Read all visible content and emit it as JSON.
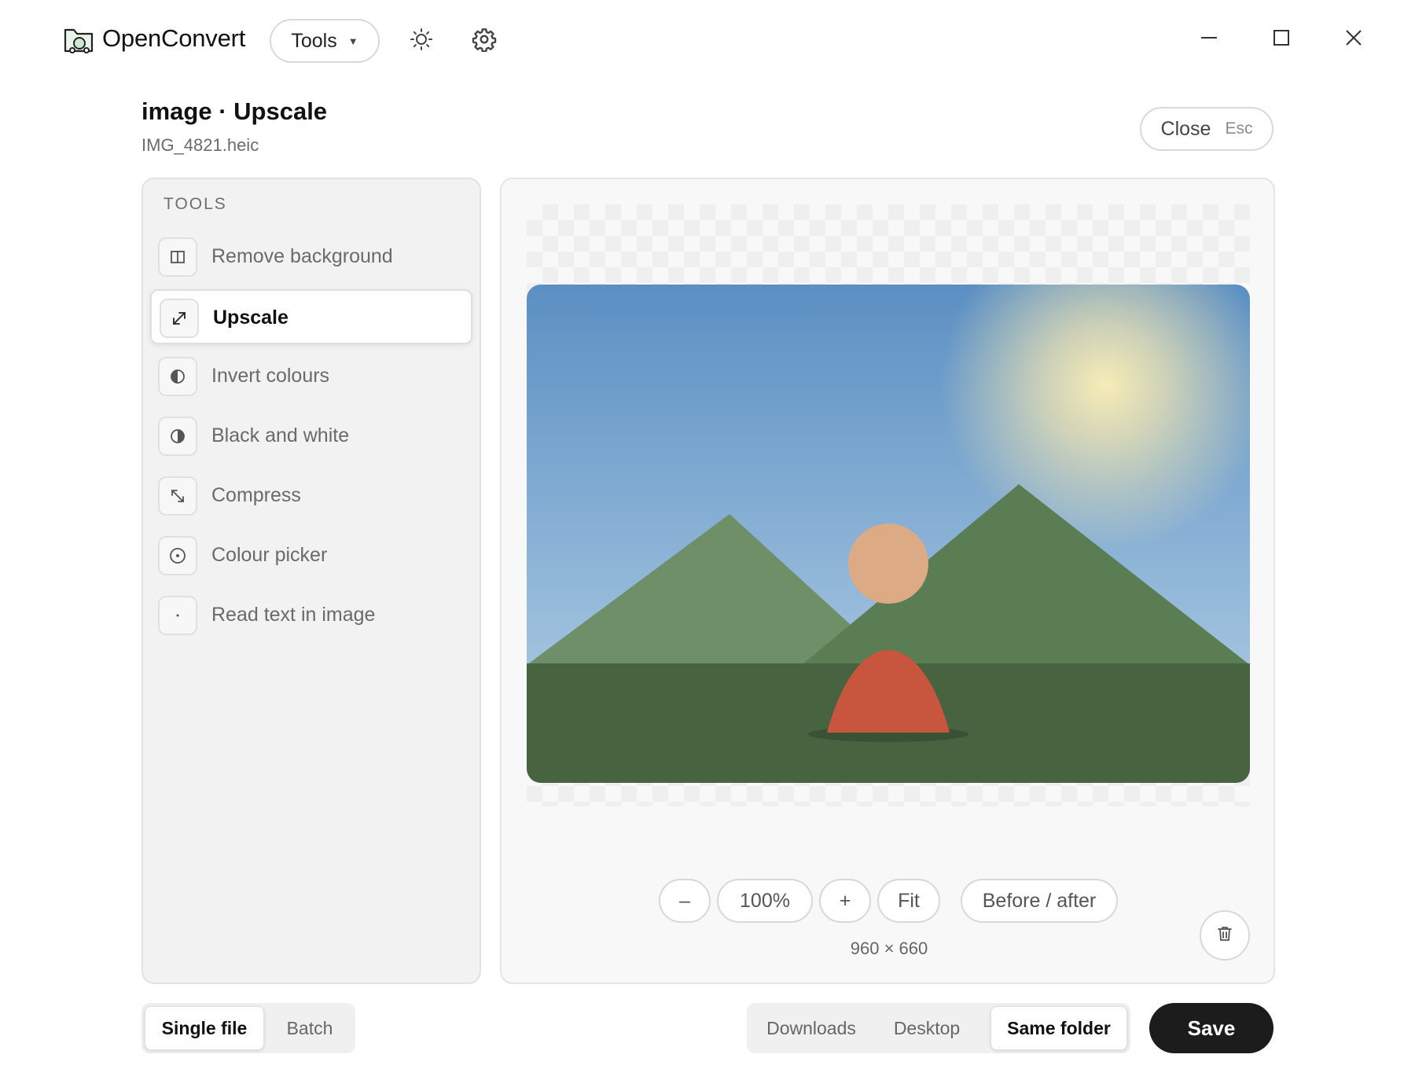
{
  "app": {
    "name": "OpenConvert"
  },
  "titlebar": {
    "tools_label": "Tools"
  },
  "header": {
    "title": "image · Upscale",
    "file_name": "IMG_4821.heic",
    "close_label": "Close",
    "close_shortcut": "Esc"
  },
  "sidebar": {
    "heading": "TOOLS",
    "items": [
      {
        "label": "Remove background",
        "icon": "remove-background-icon"
      },
      {
        "label": "Upscale",
        "icon": "upscale-icon",
        "active": true
      },
      {
        "label": "Invert colours",
        "icon": "invert-icon"
      },
      {
        "label": "Black and white",
        "icon": "black-white-icon"
      },
      {
        "label": "Compress",
        "icon": "compress-icon"
      },
      {
        "label": "Colour picker",
        "icon": "colour-picker-icon"
      },
      {
        "label": "Read text in image",
        "icon": "read-text-icon"
      }
    ]
  },
  "preview": {
    "zoom_out": "–",
    "zoom_level": "100%",
    "zoom_in": "+",
    "fit": "Fit",
    "before_after": "Before / after",
    "dimensions": "960 × 660"
  },
  "footer": {
    "modes": [
      "Single file",
      "Batch"
    ],
    "active_mode": "Single file",
    "destinations": [
      "Downloads",
      "Desktop",
      "Same folder"
    ],
    "active_destination": "Same folder",
    "save_label": "Save"
  },
  "colors": {
    "accent": "#1c1c1c",
    "sky_top": "#5b8fc3",
    "mountain": "#6e8f68",
    "ground": "#486340",
    "tent": "#c8553d"
  }
}
